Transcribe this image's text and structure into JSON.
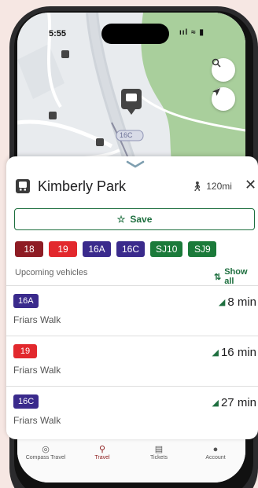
{
  "status_bar": {
    "time": "5:55",
    "icons": "ııl ≈ ▮"
  },
  "map": {
    "route_label": "16C",
    "search_icon": "search-icon",
    "locate_icon": "location-arrow-icon"
  },
  "stop": {
    "name": "Kimberly Park",
    "distance": "120mi",
    "close_label": "✕"
  },
  "save_label": "Save",
  "routes": [
    {
      "label": "18",
      "color": "#8e1c24"
    },
    {
      "label": "19",
      "color": "#e2282d"
    },
    {
      "label": "16A",
      "color": "#3a2a8c"
    },
    {
      "label": "16C",
      "color": "#3a2a8c"
    },
    {
      "label": "SJ10",
      "color": "#1b7a3a"
    },
    {
      "label": "SJ9",
      "color": "#1b7a3a"
    }
  ],
  "upcoming_label": "Upcoming vehicles",
  "show_all_label": "Show all",
  "vehicles": [
    {
      "route": "16A",
      "color": "#3a2a8c",
      "destination": "Friars Walk",
      "time": "8 min"
    },
    {
      "route": "19",
      "color": "#e2282d",
      "destination": "Friars Walk",
      "time": "16 min"
    },
    {
      "route": "16C",
      "color": "#3a2a8c",
      "destination": "Friars Walk",
      "time": "27 min"
    }
  ],
  "tabs": [
    {
      "label": "Compass Travel",
      "icon": "compass-icon"
    },
    {
      "label": "Travel",
      "icon": "pin-icon",
      "active": true
    },
    {
      "label": "Tickets",
      "icon": "ticket-icon"
    },
    {
      "label": "Account",
      "icon": "person-icon"
    }
  ],
  "colors": {
    "accent": "#1e6f3f",
    "active_tab": "#8b1a1a"
  }
}
